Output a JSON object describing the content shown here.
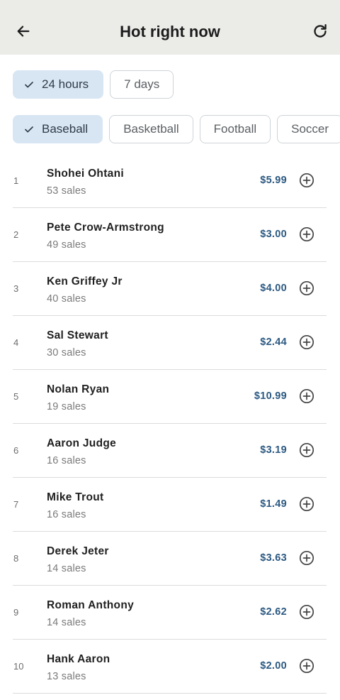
{
  "header": {
    "title": "Hot right now",
    "back_icon": "arrow-left-icon",
    "refresh_icon": "refresh-icon"
  },
  "time_filters": [
    {
      "label": "24 hours",
      "selected": true
    },
    {
      "label": "7 days",
      "selected": false
    }
  ],
  "sport_filters": [
    {
      "label": "Baseball",
      "selected": true
    },
    {
      "label": "Basketball",
      "selected": false
    },
    {
      "label": "Football",
      "selected": false
    },
    {
      "label": "Soccer",
      "selected": false
    }
  ],
  "items": [
    {
      "rank": "1",
      "name": "Shohei Ohtani",
      "sales": "53 sales",
      "price": "$5.99"
    },
    {
      "rank": "2",
      "name": "Pete Crow-Armstrong",
      "sales": "49 sales",
      "price": "$3.00"
    },
    {
      "rank": "3",
      "name": "Ken Griffey Jr",
      "sales": "40 sales",
      "price": "$4.00"
    },
    {
      "rank": "4",
      "name": "Sal Stewart",
      "sales": "30 sales",
      "price": "$2.44"
    },
    {
      "rank": "5",
      "name": "Nolan Ryan",
      "sales": "19 sales",
      "price": "$10.99"
    },
    {
      "rank": "6",
      "name": "Aaron Judge",
      "sales": "16 sales",
      "price": "$3.19"
    },
    {
      "rank": "7",
      "name": "Mike Trout",
      "sales": "16 sales",
      "price": "$1.49"
    },
    {
      "rank": "8",
      "name": "Derek Jeter",
      "sales": "14 sales",
      "price": "$3.63"
    },
    {
      "rank": "9",
      "name": "Roman Anthony",
      "sales": "14 sales",
      "price": "$2.62"
    },
    {
      "rank": "10",
      "name": "Hank Aaron",
      "sales": "13 sales",
      "price": "$2.00"
    }
  ],
  "colors": {
    "header_bg": "#ebebe8",
    "selected_chip_bg": "#d8e6f4",
    "price": "#2d5a82"
  }
}
